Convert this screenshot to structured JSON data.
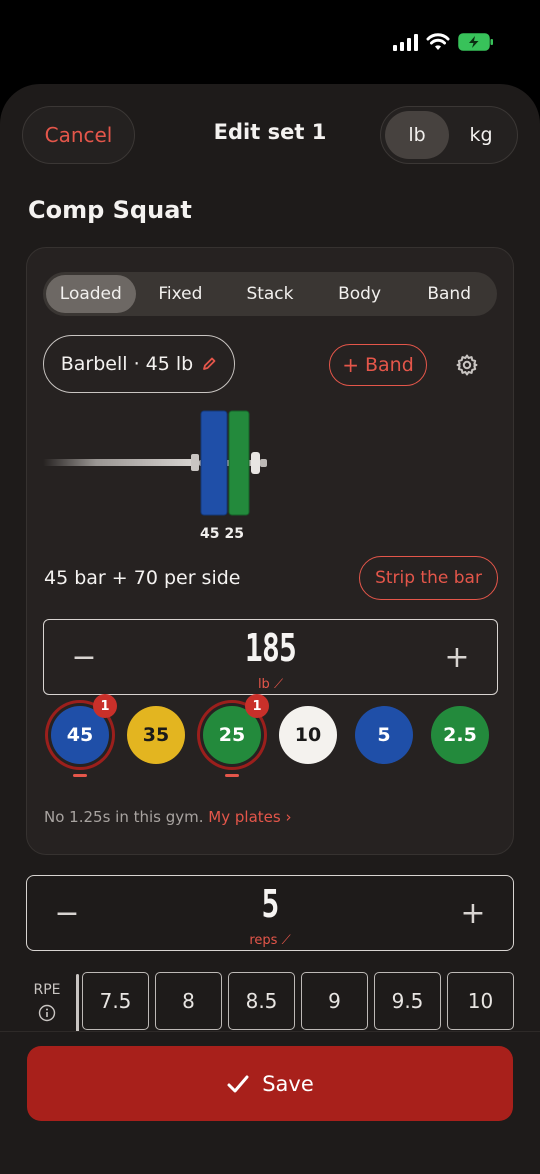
{
  "header": {
    "cancel_label": "Cancel",
    "title": "Edit set 1",
    "units": [
      "lb",
      "kg"
    ],
    "active_unit": "lb"
  },
  "exercise": {
    "name": "Comp Squat"
  },
  "equipment_tabs": {
    "items": [
      "Loaded",
      "Fixed",
      "Stack",
      "Body",
      "Band"
    ],
    "active": "Loaded"
  },
  "bar": {
    "label": "Barbell · 45 lb",
    "band_label": "Band",
    "plate_labels": [
      "45",
      "25"
    ],
    "load_text": "45 bar + 70 per side",
    "strip_label": "Strip the bar"
  },
  "weight": {
    "value": "185",
    "unit": "lb"
  },
  "plates": [
    {
      "label": "45",
      "bg": "#1f4fa8",
      "fg": "#ffffff",
      "selected": true,
      "count": "1"
    },
    {
      "label": "35",
      "bg": "#e3b520",
      "fg": "#1a1a1a",
      "selected": false,
      "count": ""
    },
    {
      "label": "25",
      "bg": "#238a3c",
      "fg": "#ffffff",
      "selected": true,
      "count": "1"
    },
    {
      "label": "10",
      "bg": "#f4f2ee",
      "fg": "#1a1a1a",
      "selected": false,
      "count": ""
    },
    {
      "label": "5",
      "bg": "#1f4fa8",
      "fg": "#ffffff",
      "selected": false,
      "count": ""
    },
    {
      "label": "2.5",
      "bg": "#238a3c",
      "fg": "#ffffff",
      "selected": false,
      "count": ""
    }
  ],
  "gym_note": {
    "text": "No 1.25s in this gym.",
    "link": "My plates ›"
  },
  "reps": {
    "value": "5",
    "unit": "reps"
  },
  "rpe": {
    "label": "RPE",
    "options": [
      "7.5",
      "8",
      "8.5",
      "9",
      "9.5",
      "10"
    ]
  },
  "footer": {
    "save_label": "Save"
  },
  "colors": {
    "accent": "#e4564a",
    "save": "#a8201b",
    "background": "#1e1b1a"
  }
}
